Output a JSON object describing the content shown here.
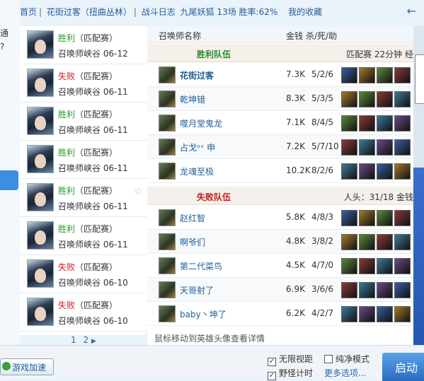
{
  "left_edge": {
    "text": "通 ?"
  },
  "breadcrumb": {
    "home": "首页",
    "server": "花街过客（扭曲丛林）",
    "log": "战斗日志",
    "summary": "九尾妖狐 13场 胜率:62%",
    "fav": "我的收藏",
    "back": "←"
  },
  "games": [
    {
      "result": "胜利",
      "type": "（匹配赛）",
      "map": "召唤师峡谷",
      "date": "06-12",
      "win": true
    },
    {
      "result": "失败",
      "type": "（匹配赛）",
      "map": "召唤师峡谷",
      "date": "06-11",
      "win": false
    },
    {
      "result": "胜利",
      "type": "（匹配赛）",
      "map": "召唤师峡谷",
      "date": "06-11",
      "win": true
    },
    {
      "result": "胜利",
      "type": "（匹配赛）",
      "map": "召唤师峡谷",
      "date": "06-11",
      "win": true
    },
    {
      "result": "胜利",
      "type": "（匹配赛）",
      "map": "召唤师峡谷",
      "date": "06-11",
      "win": true
    },
    {
      "result": "胜利",
      "type": "（匹配赛）",
      "map": "召唤师峡谷",
      "date": "06-11",
      "win": true
    },
    {
      "result": "失败",
      "type": "（匹配赛）",
      "map": "召唤师峡谷",
      "date": "06-10",
      "win": false
    },
    {
      "result": "失败",
      "type": "（匹配赛）",
      "map": "召唤师峡谷",
      "date": "06-10",
      "win": false
    }
  ],
  "pager": {
    "p1": "1",
    "p2": "2",
    "next": "▶"
  },
  "table": {
    "col_name": "召唤师名称",
    "col_gold": "金钱",
    "col_kda": "杀/死/助"
  },
  "win_team": {
    "title": "胜利队伍",
    "info": "匹配赛 22分钟 经"
  },
  "lose_team": {
    "title": "失败队伍",
    "info": "人头：31/18 金钱"
  },
  "win_players": [
    {
      "name": "花街过客",
      "gold": "7.3K",
      "kda": "5/2/6"
    },
    {
      "name": "乾坤错",
      "gold": "8.3K",
      "kda": "5/3/5"
    },
    {
      "name": "噬月堂鬼龙",
      "gold": "7.1K",
      "kda": "8/4/5"
    },
    {
      "name": "占戈ᵒˣ 申",
      "gold": "7.2K",
      "kda": "5/7/10"
    },
    {
      "name": "龙魂至极",
      "gold": "10.2K",
      "kda": "8/2/6"
    }
  ],
  "lose_players": [
    {
      "name": "赵红智",
      "gold": "5.8K",
      "kda": "4/8/3"
    },
    {
      "name": "啊爷们",
      "gold": "4.8K",
      "kda": "3/8/2"
    },
    {
      "name": "第二代菜鸟",
      "gold": "4.5K",
      "kda": "4/7/0"
    },
    {
      "name": "天哥射了",
      "gold": "6.9K",
      "kda": "3/6/6"
    },
    {
      "name": "baby丶坤了",
      "gold": "6.2K",
      "kda": "4/2/7"
    }
  ],
  "hint": "鼠标移动到英雄头像查看详情",
  "bottom": {
    "boost": "游戏加速",
    "opt1": "无限视距",
    "opt2": "纯净模式",
    "opt3": "野怪计时",
    "more": "更多选项...",
    "start": "启动"
  },
  "item_colors": [
    "#3b5fa0",
    "#a07a2a",
    "#5a8a3a",
    "#8a3a3a",
    "#3a7a9a",
    "#6a4a8a"
  ]
}
